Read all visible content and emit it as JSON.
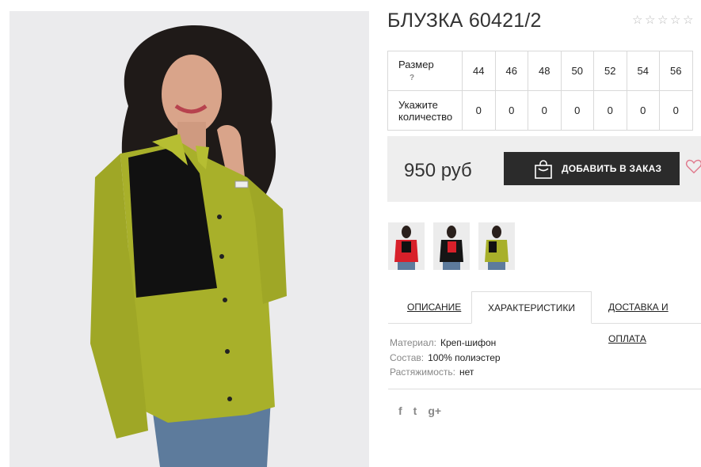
{
  "product": {
    "title": "БЛУЗКА 60421/2",
    "rating_stars": [
      "☆",
      "☆",
      "☆",
      "☆",
      "☆"
    ]
  },
  "sizes": {
    "size_label": "Размер",
    "help": "?",
    "qty_label_1": "Укажите",
    "qty_label_2": "количество",
    "values": [
      "44",
      "46",
      "48",
      "50",
      "52",
      "54",
      "56"
    ],
    "quantities": [
      "0",
      "0",
      "0",
      "0",
      "0",
      "0",
      "0"
    ]
  },
  "purchase": {
    "price": "950 руб",
    "add_button": "ДОБАВИТЬ В ЗАКАЗ"
  },
  "tabs": {
    "description": "ОПИСАНИЕ",
    "characteristics": "ХАРАКТЕРИСТИКИ",
    "delivery": "ДОСТАВКА И ОПЛАТА"
  },
  "specs": {
    "material_key": "Материал:",
    "material_val": "Креп-шифон",
    "composition_key": "Состав:",
    "composition_val": "100% полиэстер",
    "stretch_key": "Растяжимость:",
    "stretch_val": "нет"
  },
  "social": {
    "facebook": "f",
    "twitter": "t",
    "google": "g+"
  },
  "colors": {
    "blouse": "#a8b02a",
    "panel": "#111111",
    "red": "#d8202a",
    "button": "#2b2b2b",
    "bar": "#eeeeee"
  }
}
